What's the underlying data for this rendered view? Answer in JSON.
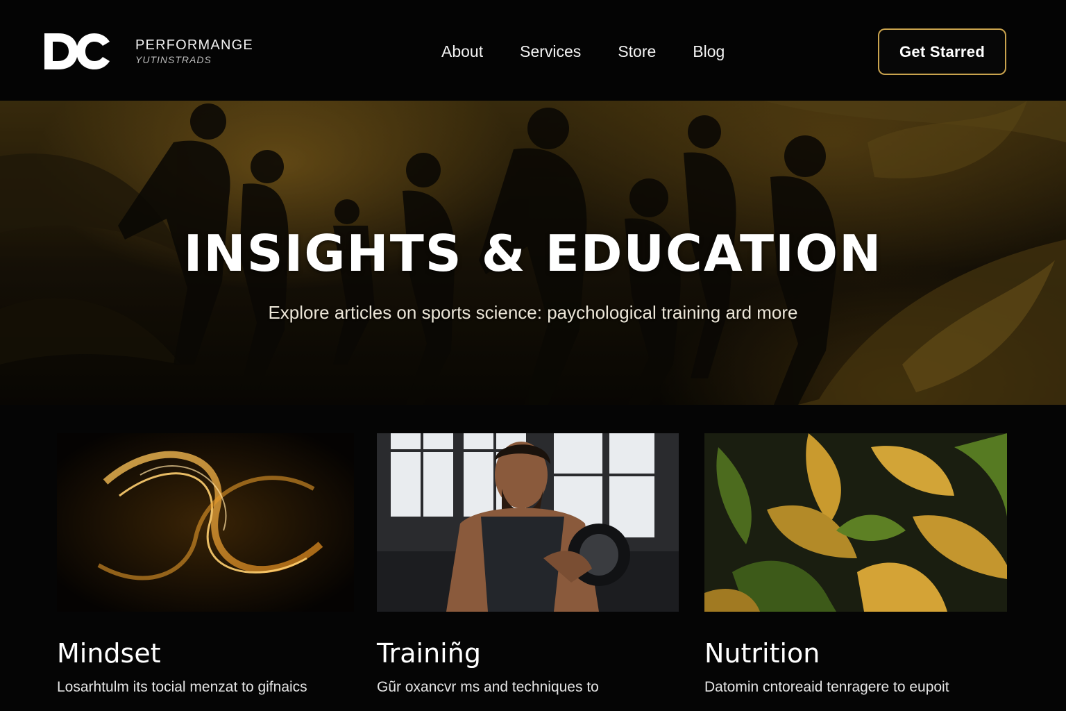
{
  "header": {
    "brand_name": "PERFORMANGE",
    "brand_tagline": "YUTINSTRADS",
    "logo_text": "DC",
    "nav": [
      {
        "label": "About"
      },
      {
        "label": "Services"
      },
      {
        "label": "Store"
      },
      {
        "label": "Blog"
      }
    ],
    "cta_label": "Get Starred"
  },
  "hero": {
    "title": "INSIGHTS & EDUCATION",
    "subtitle": "Explore articles on sports science: paychological training ard more"
  },
  "cards": [
    {
      "title": "Mindset",
      "text": "Losarhtulm its tocial menzat to gifnaics"
    },
    {
      "title": "Trainiñg",
      "text": "Gũr oxancvr ms and techniques to"
    },
    {
      "title": "Nutrition",
      "text": "Datomin cntoreaid tenragere to eupoit"
    }
  ],
  "colors": {
    "accent_gold": "#c9a34e",
    "background": "#050505",
    "text": "#ffffff"
  },
  "icons": {
    "logo": "dc-monogram-logo"
  }
}
